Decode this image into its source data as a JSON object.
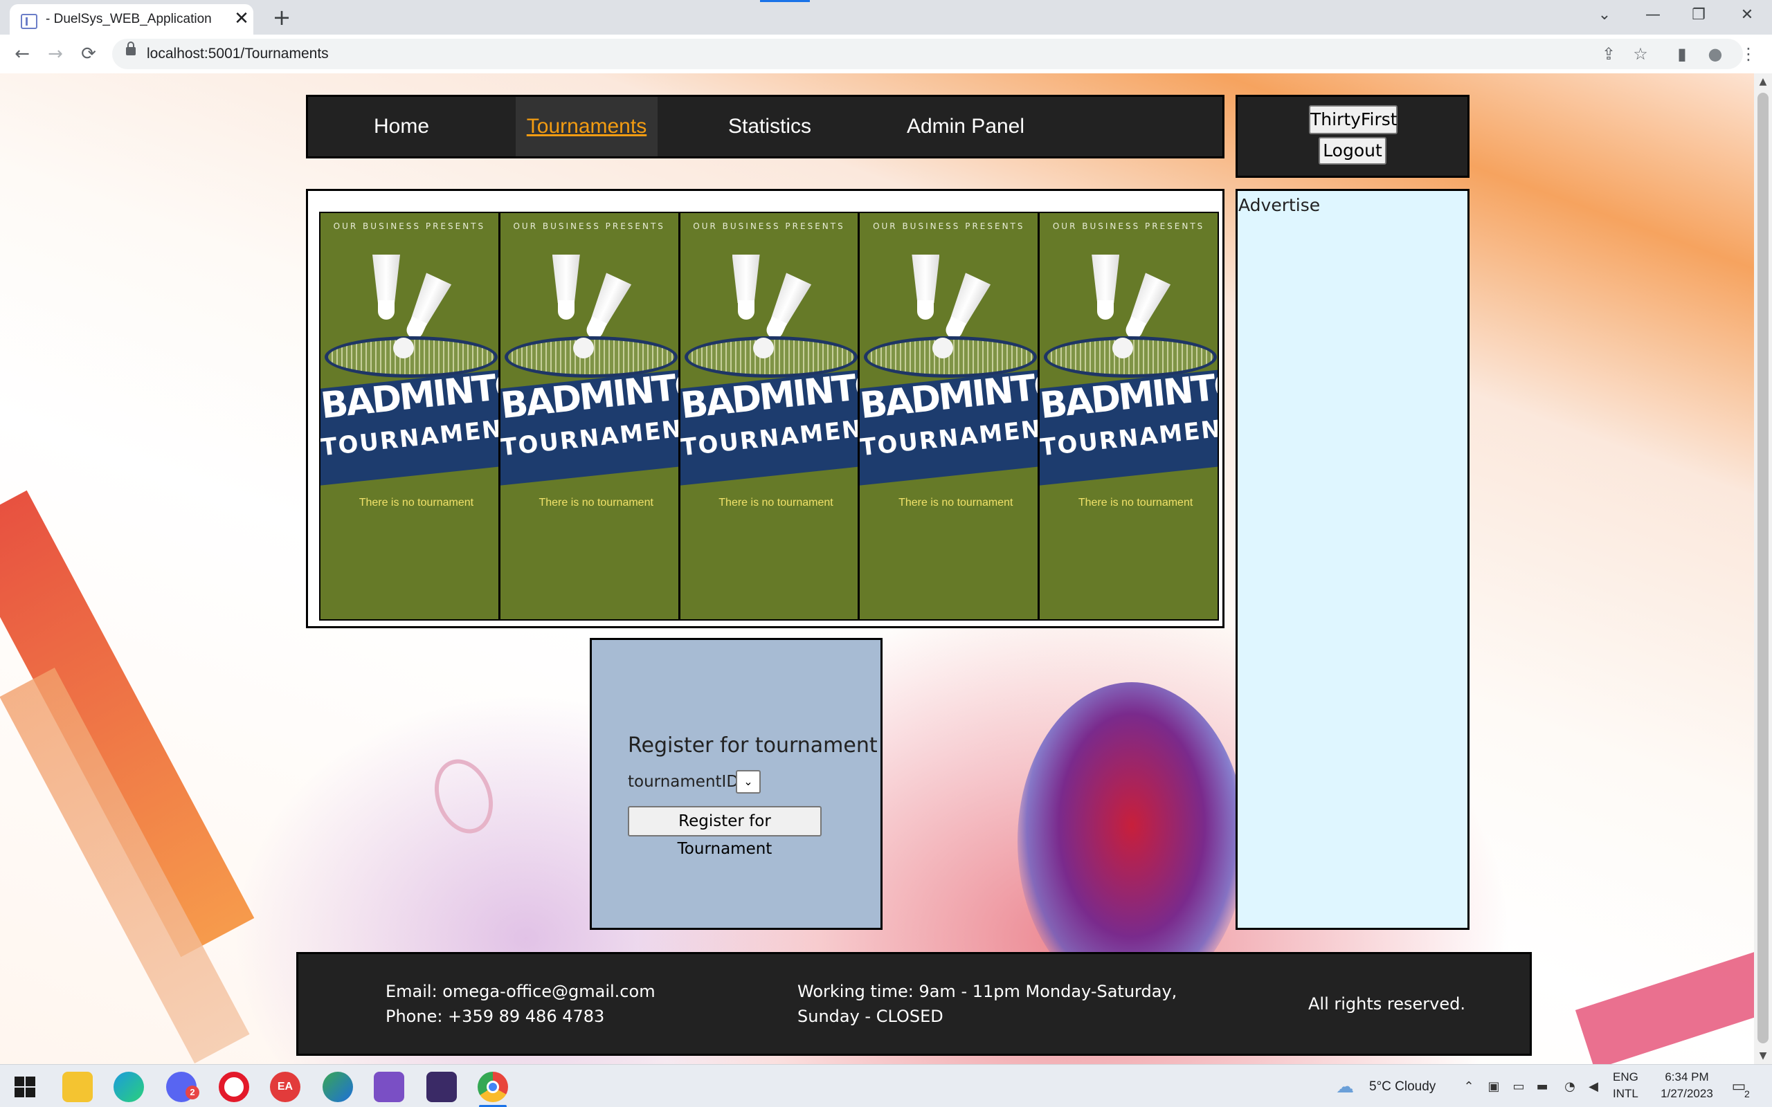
{
  "browser": {
    "tab_title": "- DuelSys_WEB_Application",
    "url": "localhost:5001/Tournaments",
    "new_tab": "+",
    "close_tab": "✕",
    "window_controls": {
      "dropdown": "⌄",
      "minimize": "—",
      "restore": "❐",
      "close": "✕"
    },
    "nav_icons": {
      "back": "←",
      "forward": "→",
      "reload": "⟳"
    },
    "toolbar_icons": {
      "share": "⇪",
      "bookmark": "☆",
      "sidepanel": "▮",
      "profile": "●",
      "menu": "⋮"
    }
  },
  "nav": {
    "items": [
      {
        "label": "Home",
        "active": false
      },
      {
        "label": "Tournaments",
        "active": true
      },
      {
        "label": "Statistics",
        "active": false
      },
      {
        "label": "Admin Panel",
        "active": false
      }
    ]
  },
  "user": {
    "username": "ThirtyFirst",
    "logout": "Logout"
  },
  "tournaments": {
    "cards": [
      {
        "subtitle": "OUR BUSINESS PRESENTS",
        "title_line1": "BADMINTON",
        "title_line2": "TOURNAMENT",
        "message": "There is no tournament"
      },
      {
        "subtitle": "OUR BUSINESS PRESENTS",
        "title_line1": "BADMINTON",
        "title_line2": "TOURNAMENT",
        "message": "There is no tournament"
      },
      {
        "subtitle": "OUR BUSINESS PRESENTS",
        "title_line1": "BADMINTON",
        "title_line2": "TOURNAMENT",
        "message": "There is no tournament"
      },
      {
        "subtitle": "OUR BUSINESS PRESENTS",
        "title_line1": "BADMINTON",
        "title_line2": "TOURNAMENT",
        "message": "There is no tournament"
      },
      {
        "subtitle": "OUR BUSINESS PRESENTS",
        "title_line1": "BADMINTON",
        "title_line2": "TOURNAMENT",
        "message": "There is no tournament"
      }
    ]
  },
  "advertise": {
    "label": "Advertise"
  },
  "register": {
    "heading": "Register for tournament",
    "field_label": "tournamentID",
    "select_value": "",
    "button": "Register for Tournament"
  },
  "footer": {
    "email": "Email: omega-office@gmail.com",
    "phone": "Phone: +359 89 486 4783",
    "hours_line1": "Working time: 9am - 11pm Monday-Saturday,",
    "hours_line2": "Sunday - CLOSED",
    "rights": "All rights reserved."
  },
  "taskbar": {
    "apps": [
      "start",
      "file-explorer",
      "edge",
      "discord",
      "opera",
      "ea",
      "maps",
      "visual-studio",
      "terminal",
      "chrome"
    ],
    "discord_badge": "2",
    "weather": "5°C  Cloudy",
    "lang_line1": "ENG",
    "lang_line2": "INTL",
    "time": "6:34 PM",
    "date": "1/27/2023",
    "notification_count": "2"
  },
  "colors": {
    "nav_bg": "#222222",
    "nav_active_text": "#f39c12",
    "card_green": "#667a28",
    "card_banner": "#1d3c6e",
    "card_message": "#f1e26a",
    "advertise_bg": "#dff6ff",
    "register_bg": "#a7bbd3"
  }
}
